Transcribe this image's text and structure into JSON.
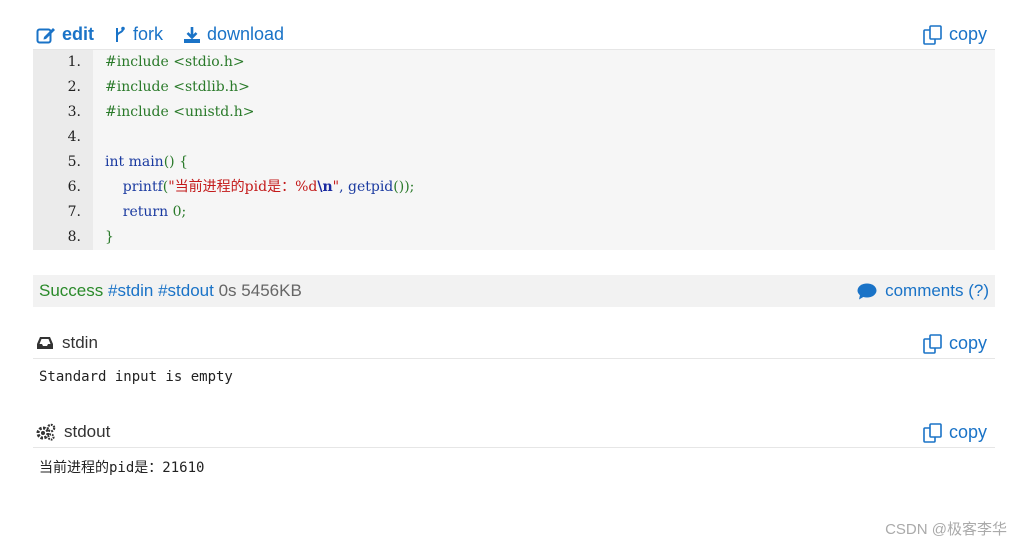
{
  "toolbar": {
    "edit": "edit",
    "fork": "fork",
    "download": "download",
    "copy": "copy"
  },
  "code": {
    "lines": [
      {
        "n": "1.",
        "tokens": [
          {
            "t": "#include <stdio.h>",
            "c": "pp"
          }
        ]
      },
      {
        "n": "2.",
        "tokens": [
          {
            "t": "#include <stdlib.h>",
            "c": "pp"
          }
        ]
      },
      {
        "n": "3.",
        "tokens": [
          {
            "t": "#include <unistd.h>",
            "c": "pp"
          }
        ]
      },
      {
        "n": "4.",
        "tokens": []
      },
      {
        "n": "5.",
        "tokens": [
          {
            "t": "int",
            "c": "kw"
          },
          {
            "t": " main",
            "c": "plain"
          },
          {
            "t": "() {",
            "c": "pun"
          }
        ]
      },
      {
        "n": "6.",
        "tokens": [
          {
            "t": "    printf",
            "c": "fn"
          },
          {
            "t": "(",
            "c": "pun"
          },
          {
            "t": "\"当前进程的pid是：%d",
            "c": "str"
          },
          {
            "t": "\\n",
            "c": "esc"
          },
          {
            "t": "\"",
            "c": "str"
          },
          {
            "t": ", getpid",
            "c": "plain"
          },
          {
            "t": "());",
            "c": "pun"
          }
        ]
      },
      {
        "n": "7.",
        "tokens": [
          {
            "t": "    return",
            "c": "kw"
          },
          {
            "t": " 0",
            "c": "num"
          },
          {
            "t": ";",
            "c": "pun"
          }
        ]
      },
      {
        "n": "8.",
        "tokens": [
          {
            "t": "}",
            "c": "pun"
          }
        ]
      }
    ]
  },
  "status": {
    "result": "Success",
    "tag_stdin": "#stdin",
    "tag_stdout": "#stdout",
    "time": "0s",
    "memory": "5456KB",
    "comments": "comments (?)"
  },
  "stdin": {
    "title": "stdin",
    "copy": "copy",
    "content": "Standard input is empty"
  },
  "stdout": {
    "title": "stdout",
    "copy": "copy",
    "content": "当前进程的pid是：21610"
  },
  "watermark": "CSDN @极客李华",
  "colors": {
    "link": "#1a73c7",
    "success": "#2a8a2a",
    "code_bg": "#f6f6f6",
    "gutter_bg": "#ebebeb"
  }
}
